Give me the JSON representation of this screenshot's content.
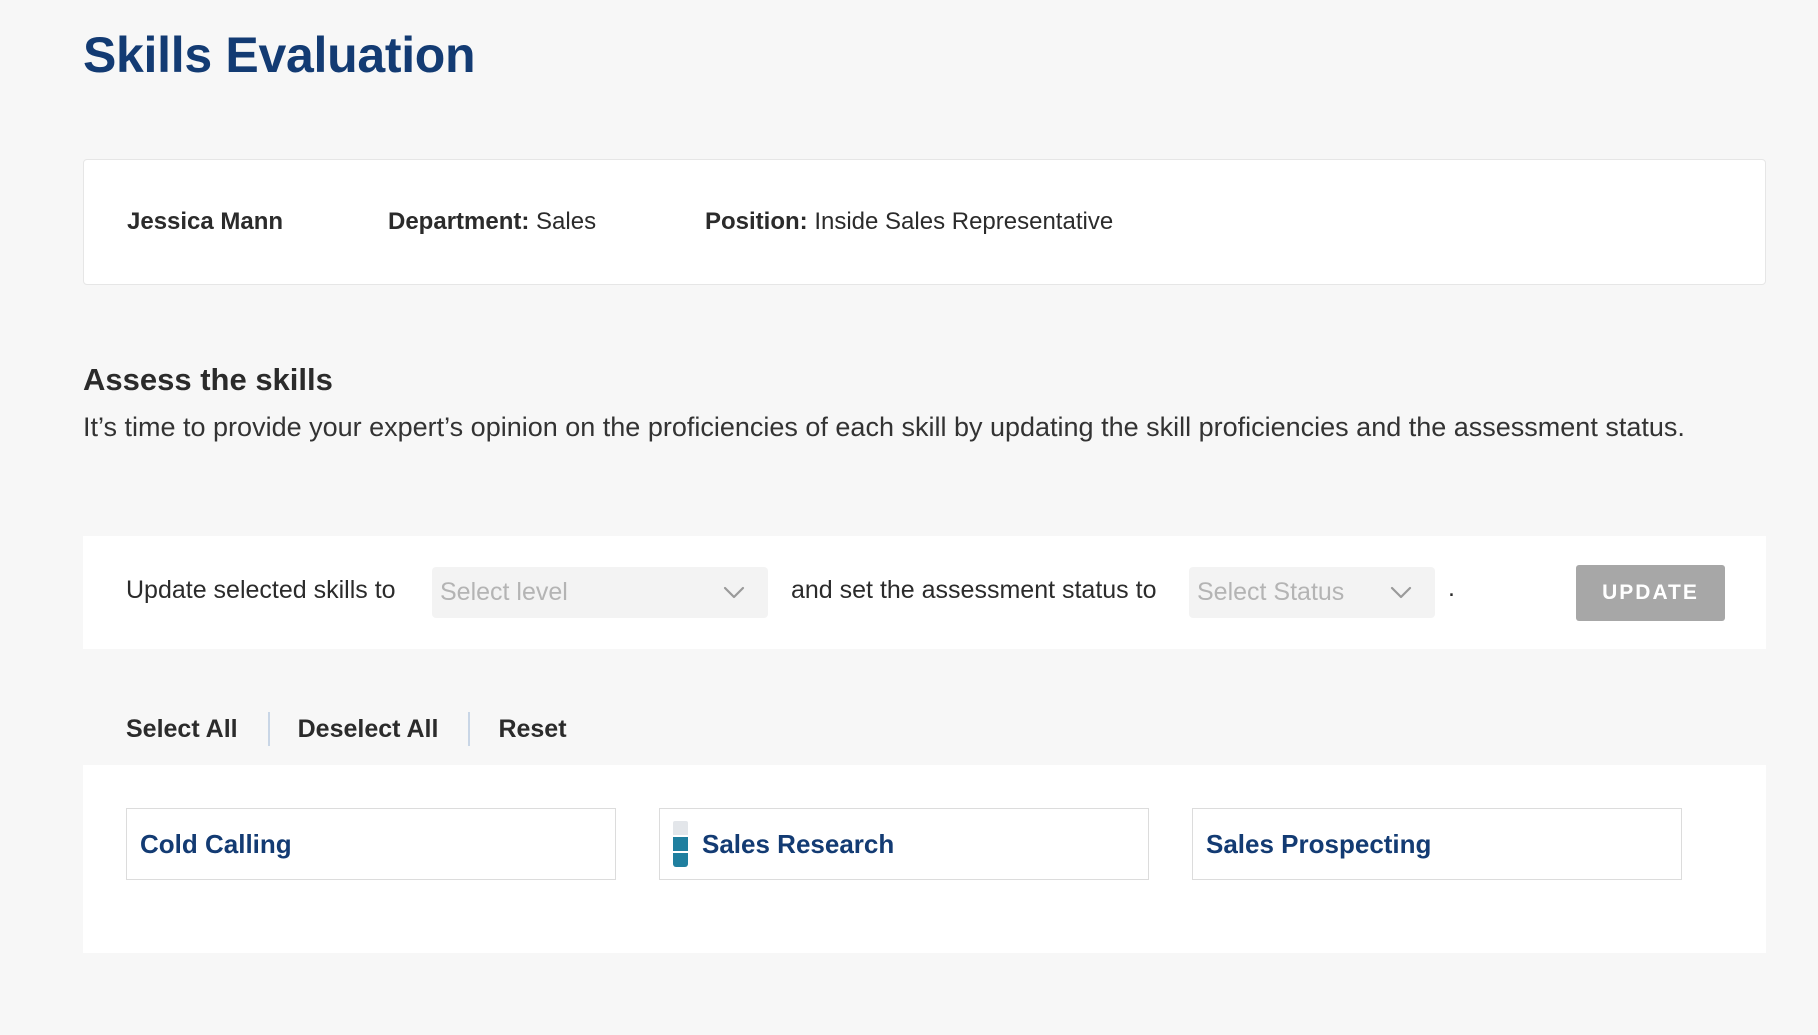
{
  "header": {
    "title": "Skills Evaluation"
  },
  "employee": {
    "name": "Jessica Mann",
    "department_label": "Department:",
    "department": "Sales",
    "position_label": "Position:",
    "position": "Inside Sales Representative"
  },
  "assess": {
    "title": "Assess the skills",
    "description": "It’s time to provide your expert’s opinion on the proficiencies of each skill by updating the skill proficiencies and the assessment status."
  },
  "bulk_update": {
    "prefix_text": "Update selected skills to",
    "level_placeholder": "Select level",
    "middle_text": "and set the assessment status to",
    "status_placeholder": "Select Status",
    "suffix_text": ".",
    "update_label": "UPDATE",
    "update_enabled": false,
    "chevron_icon": "chevron-down-icon"
  },
  "selection_actions": {
    "select_all": "Select All",
    "deselect_all": "Deselect All",
    "reset": "Reset"
  },
  "skills": [
    {
      "name": "Cold Calling",
      "level": null
    },
    {
      "name": "Sales Research",
      "level": 2,
      "level_max": 3
    },
    {
      "name": "Sales Prospecting",
      "level": null
    }
  ],
  "colors": {
    "title": "#133b73",
    "skill_link": "#133b73",
    "level_fill": "#1f7f9f",
    "level_empty": "#e3e6ea",
    "button_disabled": "#a7a7a7",
    "page_background": "#f7f7f7"
  }
}
